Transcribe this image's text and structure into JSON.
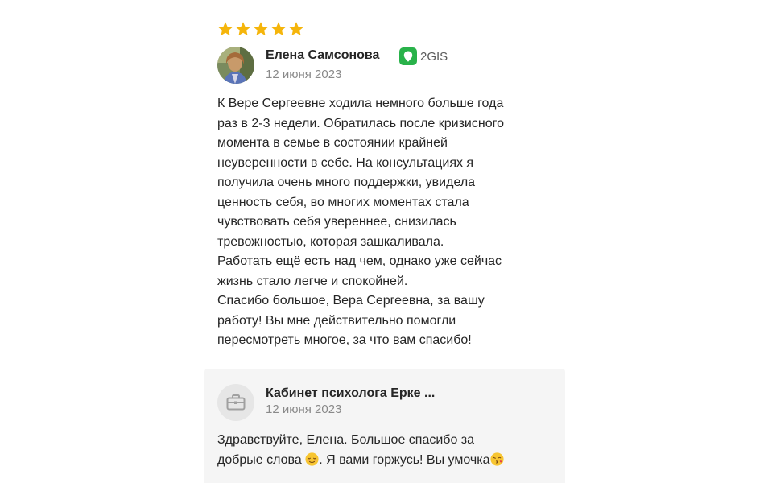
{
  "review": {
    "rating": 5,
    "rating_max": 5,
    "star_color": "#f5b50b",
    "author": {
      "name": "Елена Самсонова",
      "avatar_icon": "user-photo-avatar"
    },
    "source": {
      "label": "2GIS",
      "icon": "2gis-logo-icon",
      "color": "#29b24a"
    },
    "date": "12 июня 2023",
    "text_lines": [
      "К Вере Сергеевне ходила немного больше года",
      "раз в 2-3 недели. Обратилась после кризисного",
      "момента в семье в состоянии крайней",
      "неуверенности в себе. На консультациях я",
      "получила очень много поддержки, увидела",
      "ценность себя, во многих моментах стала",
      "чувствовать себя увереннее, снизилась",
      "тревожностью, которая зашкаливала.",
      "Работать ещё есть над чем, однако уже сейчас",
      "жизнь стало легче и спокойней.",
      "Спасибо большое, Вера Сергеевна, за вашу",
      "работу! Вы мне действительно помогли",
      "пересмотреть многое, за что вам спасибо!"
    ]
  },
  "reply": {
    "author": "Кабинет психолога Ерке ...",
    "avatar_icon": "briefcase-icon",
    "date": "12 июня 2023",
    "line1": "Здравствуйте, Елена. Большое спасибо за",
    "line2_part1": "добрые слова ",
    "line2_part2": ". Я вами горжусь! Вы умочка",
    "emoji_1": "relieved-face-emoji",
    "emoji_2": "face-blowing-kiss-emoji"
  }
}
